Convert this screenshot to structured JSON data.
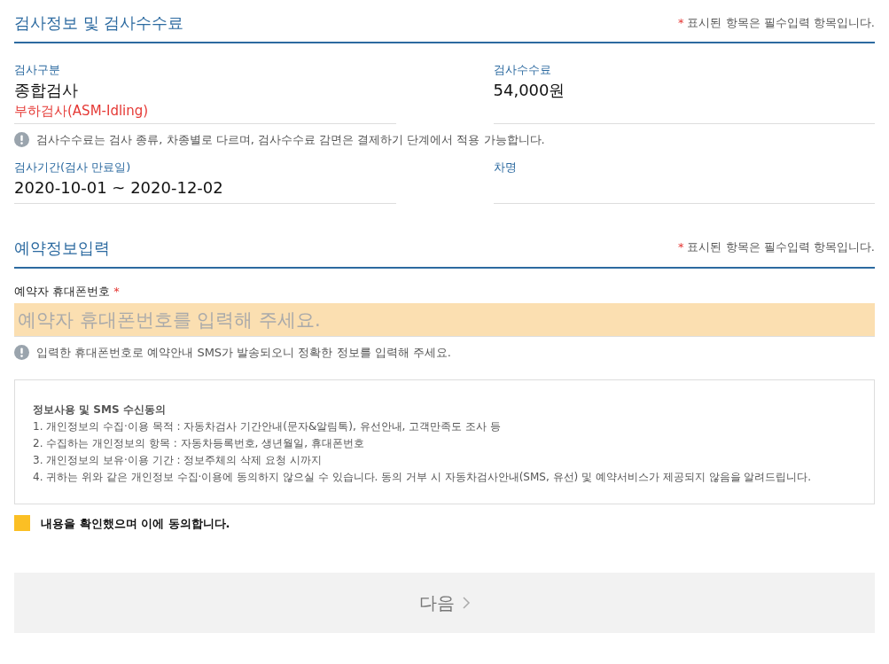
{
  "sections": [
    {
      "title": "검사정보 및 검사수수료",
      "required_note": "표시된 항목은 필수입력 항목입니다.",
      "required_mark": "*"
    },
    {
      "title": "예약정보입력",
      "required_note": "표시된 항목은 필수입력 항목입니다.",
      "required_mark": "*"
    }
  ],
  "info": {
    "rows": [
      {
        "fields": [
          {
            "label": "검사구분",
            "value": "종합검사",
            "sub": "부하검사(ASM-Idling)"
          },
          {
            "label": "검사수수료",
            "value": "54,000원"
          }
        ],
        "notice": "검사수수료는 검사 종류, 차종별로 다르며, 검사수수료 감면은 결제하기 단계에서 적용 가능합니다."
      },
      {
        "fields": [
          {
            "label": "검사기간(검사 만료일)",
            "value": "2020-10-01 ~ 2020-12-02"
          },
          {
            "label": "차명"
          }
        ]
      }
    ]
  },
  "phone": {
    "label": "예약자 휴대폰번호",
    "required_mark": "*",
    "placeholder": "예약자 휴대폰번호를 입력해 주세요.",
    "notice": "입력한 휴대폰번호로 예약안내 SMS가 발송되오니 정확한 정보를 입력해 주세요."
  },
  "consent": {
    "title": "정보사용 및 SMS 수신동의",
    "lines": [
      "1. 개인정보의 수집·이용 목적 : 자동차검사 기간안내(문자&알림톡), 유선안내, 고객만족도 조사 등",
      "2. 수집하는 개인정보의 항목 : 자동차등록번호, 생년월일, 휴대폰번호",
      "3. 개인정보의 보유·이용 기간 : 정보주체의 삭제 요청 시까지",
      "4. 귀하는 위와 같은 개인정보 수집·이용에 동의하지 않으실 수 있습니다. 동의 거부 시 자동차검사안내(SMS, 유선) 및 예약서비스가 제공되지 않음을 알려드립니다."
    ],
    "agree": {
      "label": "내용을 확인했으며 이에 동의합니다.",
      "checked": false
    }
  },
  "next_button": {
    "label": "다음",
    "disabled": true
  }
}
